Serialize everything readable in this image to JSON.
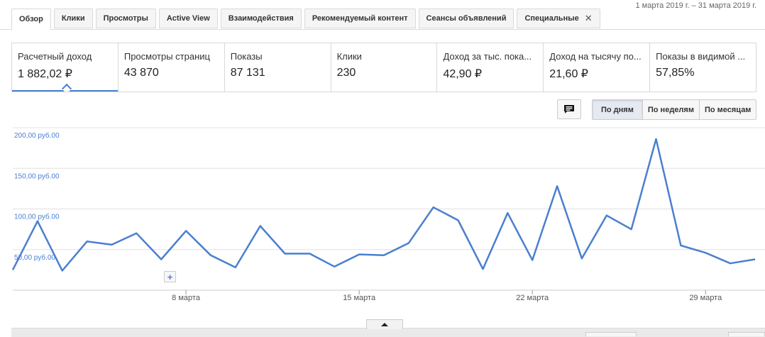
{
  "date_range": "1 марта 2019 г. – 31 марта 2019 г.",
  "tabs": [
    {
      "label": "Обзор",
      "active": true
    },
    {
      "label": "Клики"
    },
    {
      "label": "Просмотры"
    },
    {
      "label": "Active View"
    },
    {
      "label": "Взаимодействия"
    },
    {
      "label": "Рекомендуемый контент"
    },
    {
      "label": "Сеансы объявлений"
    },
    {
      "label": "Специальные",
      "closable": true
    }
  ],
  "metrics": [
    {
      "label": "Расчетный доход",
      "value": "1 882,02 ₽",
      "active": true
    },
    {
      "label": "Просмотры страниц",
      "value": "43 870"
    },
    {
      "label": "Показы",
      "value": "87 131"
    },
    {
      "label": "Клики",
      "value": "230"
    },
    {
      "label": "Доход за тыс. пока...",
      "value": "42,90 ₽"
    },
    {
      "label": "Доход на тысячу по...",
      "value": "21,60 ₽"
    },
    {
      "label": "Показы в видимой ...",
      "value": "57,85%"
    }
  ],
  "granularity": [
    "По дням",
    "По неделям",
    "По месяцам"
  ],
  "granularity_selected": "По дням",
  "icons": {
    "comment": "comment-icon",
    "add_annotation": "plus-icon",
    "collapse": "caret-up-icon",
    "close": "close-icon"
  },
  "colors": {
    "line": "#4a7fd0",
    "axis_label": "#4a7fd0",
    "grid": "#e0e0e0"
  },
  "chart_data": {
    "type": "line",
    "series": [
      {
        "values": [
          25,
          85,
          24,
          60,
          56,
          70,
          38,
          73,
          43,
          28,
          79,
          45,
          45,
          29,
          44,
          43,
          58,
          102,
          86,
          26,
          95,
          37,
          128,
          39,
          92,
          75,
          186,
          55,
          46,
          33,
          38
        ]
      }
    ],
    "x": [
      1,
      2,
      3,
      4,
      5,
      6,
      7,
      8,
      9,
      10,
      11,
      12,
      13,
      14,
      15,
      16,
      17,
      18,
      19,
      20,
      21,
      22,
      23,
      24,
      25,
      26,
      27,
      28,
      29,
      30,
      31
    ],
    "x_tick_labels": [
      {
        "day": 8,
        "label": "8 марта"
      },
      {
        "day": 15,
        "label": "15 марта"
      },
      {
        "day": 22,
        "label": "22 марта"
      },
      {
        "day": 29,
        "label": "29 марта"
      }
    ],
    "y_tick_labels": [
      {
        "value": 200,
        "label": "200,00 руб.00"
      },
      {
        "value": 150,
        "label": "150,00 руб.00"
      },
      {
        "value": 100,
        "label": "100,00 руб.00"
      },
      {
        "value": 50,
        "label": "50,00 руб.00"
      }
    ],
    "ylim": [
      0,
      200
    ],
    "grid": true
  }
}
